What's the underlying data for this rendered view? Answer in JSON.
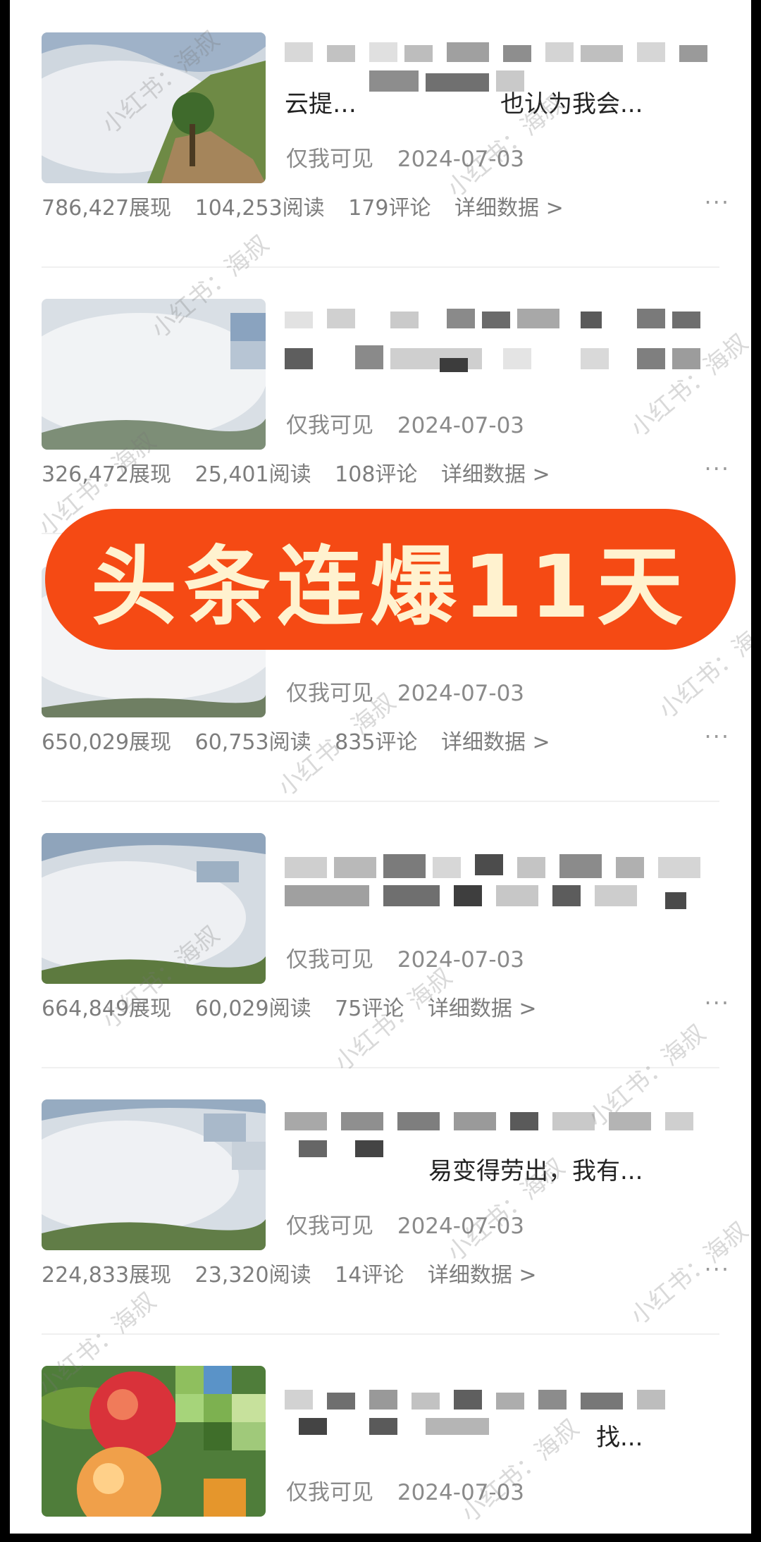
{
  "colors": {
    "banner_fill": "#f54a14",
    "banner_text": "#fff2cf",
    "stat_text": "#7d7d7d",
    "meta_text": "#8a8a8a"
  },
  "banner": {
    "text": "头条连爆11天"
  },
  "watermark": {
    "text": "小红书：海叔"
  },
  "items": [
    {
      "title_line1": "",
      "title_line2": "云提…　　　　　　也认为我会...",
      "visibility": "仅我可见",
      "date": "2024-07-03",
      "impressions": "786,427展现",
      "reads": "104,253阅读",
      "comments": "179评论",
      "details": "详细数据 >",
      "more": "···"
    },
    {
      "title_line1": "",
      "title_line2": "",
      "visibility": "仅我可见",
      "date": "2024-07-03",
      "impressions": "326,472展现",
      "reads": "25,401阅读",
      "comments": "108评论",
      "details": "详细数据 >",
      "more": "···"
    },
    {
      "title_line1": "",
      "title_line2": "...",
      "visibility": "仅我可见",
      "date": "2024-07-03",
      "impressions": "650,029展现",
      "reads": "60,753阅读",
      "comments": "835评论",
      "details": "详细数据 >",
      "more": "···"
    },
    {
      "title_line1": "",
      "title_line2": "",
      "visibility": "仅我可见",
      "date": "2024-07-03",
      "impressions": "664,849展现",
      "reads": "60,029阅读",
      "comments": "75评论",
      "details": "详细数据 >",
      "more": "···"
    },
    {
      "title_line1": "",
      "title_line2": "　　　　　　易变得劳出，我有...",
      "visibility": "仅我可见",
      "date": "2024-07-03",
      "impressions": "224,833展现",
      "reads": "23,320阅读",
      "comments": "14评论",
      "details": "详细数据 >",
      "more": "···"
    },
    {
      "title_line1": "",
      "title_line2": "　　　　　　　　　　　　　找...",
      "visibility": "仅我可见",
      "date": "2024-07-03",
      "impressions": "",
      "reads": "",
      "comments": "",
      "details": "",
      "more": ""
    }
  ]
}
